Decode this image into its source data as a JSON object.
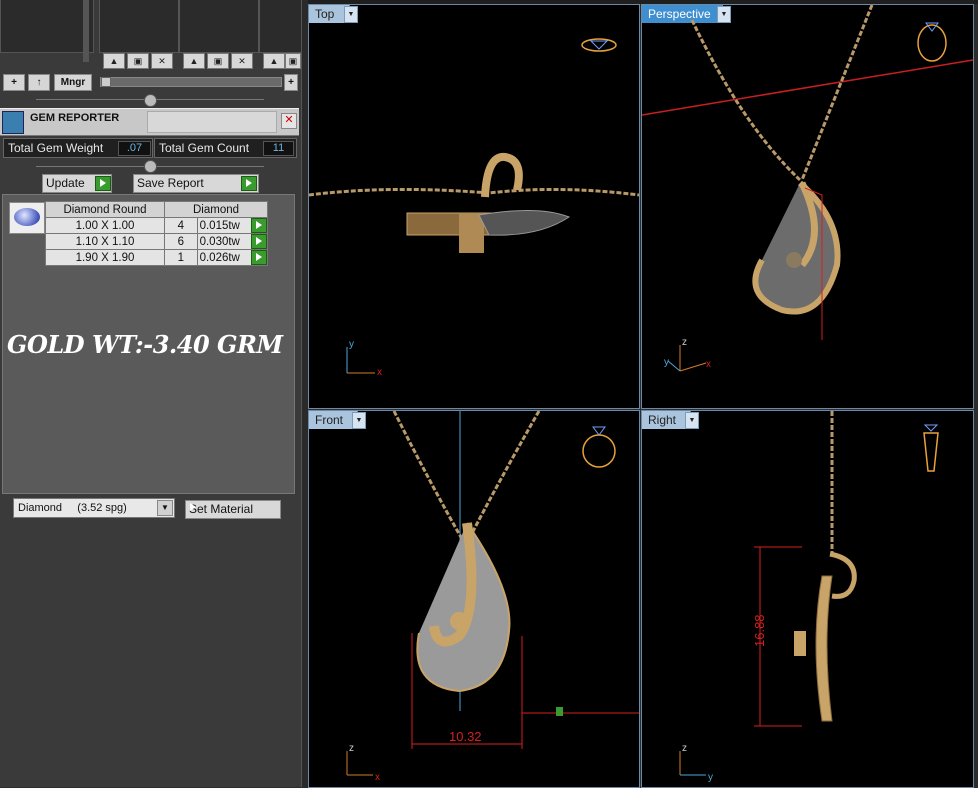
{
  "thumb_panel": {
    "mngr_label": "Mngr",
    "plus_label": "+",
    "up_label": "↑"
  },
  "gem_reporter": {
    "title": "GEM REPORTER",
    "close_glyph": "✕",
    "total_weight_label": "Total Gem Weight",
    "total_weight_value": ".07",
    "total_count_label": "Total Gem Count",
    "total_count_value": "11",
    "update_label": "Update",
    "save_report_label": "Save Report",
    "table": {
      "headers": [
        "Diamond Round",
        "Diamond"
      ],
      "rows": [
        {
          "size": "1.00 X 1.00",
          "count": "4",
          "weight": "0.015tw"
        },
        {
          "size": "1.10 X 1.10",
          "count": "6",
          "weight": "0.030tw"
        },
        {
          "size": "1.90 X 1.90",
          "count": "1",
          "weight": "0.026tw"
        }
      ]
    },
    "gold_weight_text": "GOLD WT:-3.40 GRM",
    "material_value": "Diamond     (3.52 spg)",
    "set_material_label": "Set Material"
  },
  "viewports": {
    "top": {
      "label": "Top",
      "axis_x": "x",
      "axis_y": "y"
    },
    "perspective": {
      "label": "Perspective",
      "axis_x": "x",
      "axis_y": "y",
      "axis_z": "z"
    },
    "front": {
      "label": "Front",
      "axis_x": "x",
      "axis_z": "z",
      "dimension": "10.32"
    },
    "right": {
      "label": "Right",
      "axis_y": "y",
      "axis_z": "z",
      "dimension": "16.88"
    }
  },
  "colors": {
    "accent_blue": "#3f8fd0",
    "gold": "#c8a469",
    "dimension_red": "#d42020",
    "axis_blue": "#4aa8d8"
  }
}
